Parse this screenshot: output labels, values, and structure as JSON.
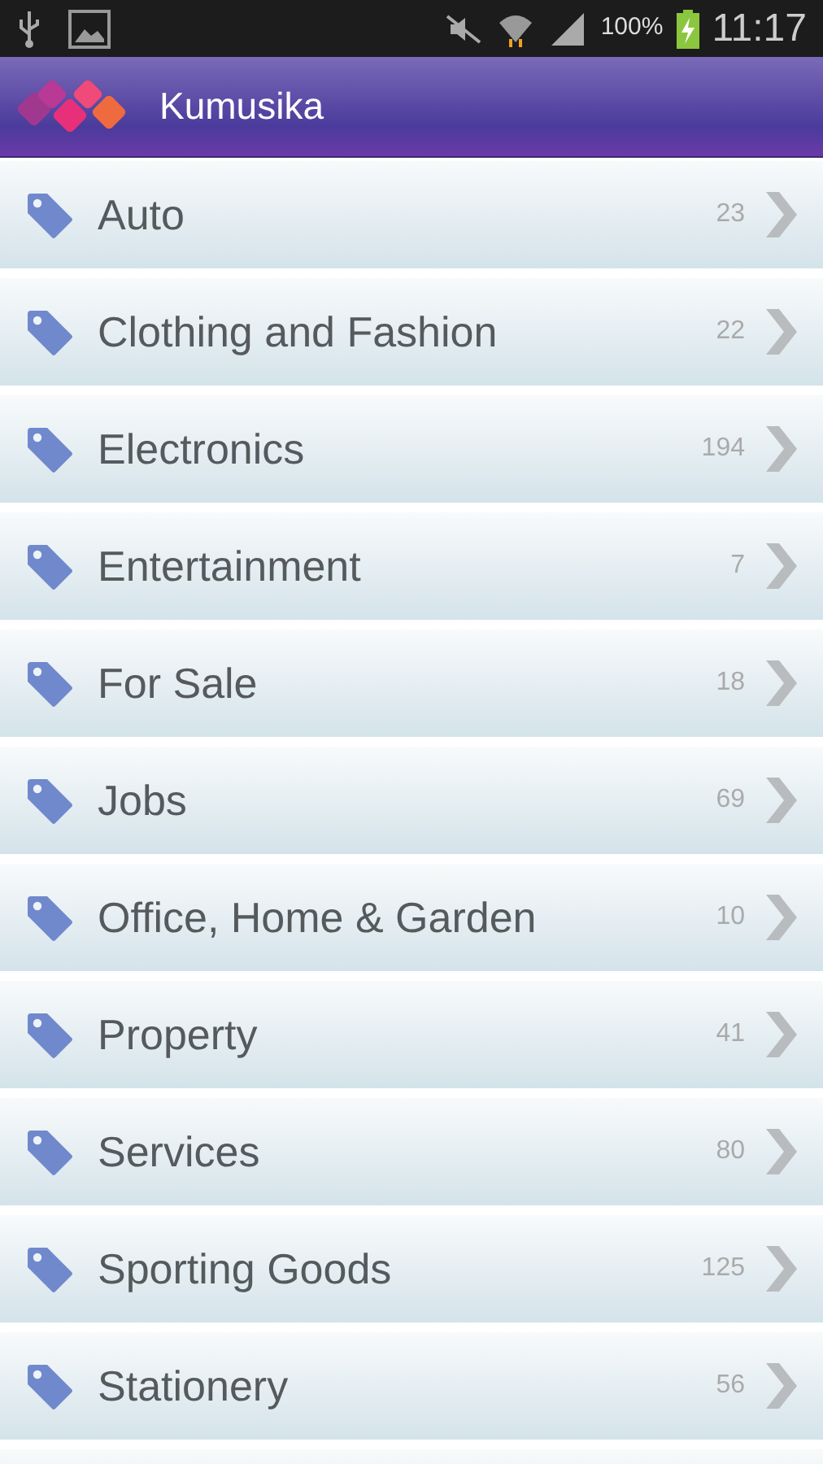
{
  "status_bar": {
    "battery": "100%",
    "time": "11:17"
  },
  "app_bar": {
    "title": "Kumusika"
  },
  "categories": [
    {
      "name": "Auto",
      "count": "23"
    },
    {
      "name": "Clothing and Fashion",
      "count": "22"
    },
    {
      "name": "Electronics",
      "count": "194"
    },
    {
      "name": "Entertainment",
      "count": "7"
    },
    {
      "name": "For Sale",
      "count": "18"
    },
    {
      "name": "Jobs",
      "count": "69"
    },
    {
      "name": "Office, Home & Garden",
      "count": "10"
    },
    {
      "name": "Property",
      "count": "41"
    },
    {
      "name": "Services",
      "count": "80"
    },
    {
      "name": "Sporting Goods",
      "count": "125"
    },
    {
      "name": "Stationery",
      "count": "56"
    }
  ]
}
